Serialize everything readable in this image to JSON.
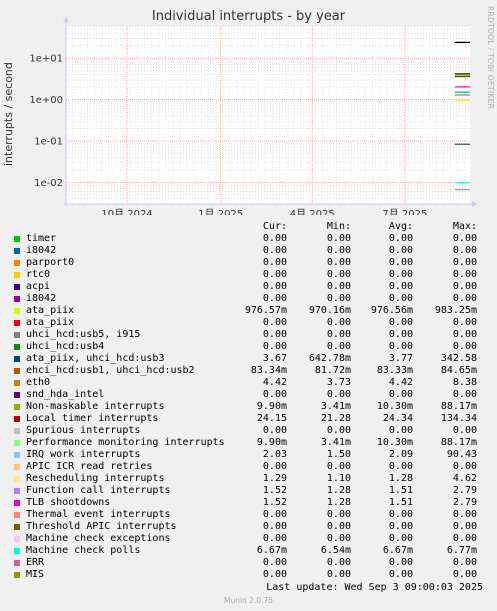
{
  "chart_data": {
    "type": "line",
    "title": "Individual interrupts - by year",
    "ylabel": "interrupts / second",
    "yscale": "log",
    "y_ticks": [
      {
        "value": 10,
        "label": "1e+01"
      },
      {
        "value": 1,
        "label": "1e+00"
      },
      {
        "value": 0.1,
        "label": "1e-01"
      },
      {
        "value": 0.01,
        "label": "1e-02"
      }
    ],
    "ylim": [
      0.003,
      60
    ],
    "x_ticks": [
      {
        "value": "2024-10-01",
        "label": "10月 2024"
      },
      {
        "value": "2025-01-01",
        "label": "1月 2025"
      },
      {
        "value": "2025-04-01",
        "label": "4月 2025"
      },
      {
        "value": "2025-07-01",
        "label": "7月 2025"
      }
    ],
    "xlim": [
      "2024-08-02",
      "2025-09-03"
    ],
    "grid": true,
    "segments": [
      {
        "color": "#cc0000",
        "x": [
          "2025-08-19",
          "2025-09-03"
        ],
        "y": 24.15
      },
      {
        "color": "#000000",
        "x": [
          "2025-08-19",
          "2025-09-03"
        ],
        "y": 24.0
      },
      {
        "color": "#c4a000",
        "x": [
          "2025-08-19",
          "2025-09-03"
        ],
        "y": 3.9
      },
      {
        "color": "#003333",
        "x": [
          "2025-08-19",
          "2025-09-03"
        ],
        "y": 4.2
      },
      {
        "color": "#336600",
        "x": [
          "2025-08-19",
          "2025-09-03"
        ],
        "y": 3.6
      },
      {
        "color": "#ff00ff",
        "x": [
          "2025-08-19",
          "2025-09-03"
        ],
        "y": 2.03
      },
      {
        "color": "#00aaaa",
        "x": [
          "2025-08-19",
          "2025-09-03"
        ],
        "y": 1.52
      },
      {
        "color": "#999900",
        "x": [
          "2025-08-19",
          "2025-09-03"
        ],
        "y": 1.29
      },
      {
        "color": "#ffd700",
        "x": [
          "2025-08-19",
          "2025-09-03"
        ],
        "y": 0.977
      },
      {
        "color": "#cc6600",
        "x": [
          "2025-08-19",
          "2025-09-03"
        ],
        "y": 0.0833
      },
      {
        "color": "#336666",
        "x": [
          "2025-08-19",
          "2025-09-03"
        ],
        "y": 0.0833
      },
      {
        "color": "#33ffcc",
        "x": [
          "2025-08-19",
          "2025-09-03"
        ],
        "y": 0.0099
      },
      {
        "color": "#33cccc",
        "x": [
          "2025-08-19",
          "2025-09-03"
        ],
        "y": 0.00667
      }
    ]
  },
  "legend": {
    "headers": {
      "cur": "Cur:",
      "min": "Min:",
      "avg": "Avg:",
      "max": "Max:"
    },
    "rows": [
      {
        "name": "timer",
        "color": "#00cc00",
        "cur": "0.00",
        "min": "0.00",
        "avg": "0.00",
        "max": "0.00"
      },
      {
        "name": "i8042",
        "color": "#0066b3",
        "cur": "0.00",
        "min": "0.00",
        "avg": "0.00",
        "max": "0.00"
      },
      {
        "name": "parport0",
        "color": "#ff8000",
        "cur": "0.00",
        "min": "0.00",
        "avg": "0.00",
        "max": "0.00"
      },
      {
        "name": "rtc0",
        "color": "#ffcc00",
        "cur": "0.00",
        "min": "0.00",
        "avg": "0.00",
        "max": "0.00"
      },
      {
        "name": "acpi",
        "color": "#330099",
        "cur": "0.00",
        "min": "0.00",
        "avg": "0.00",
        "max": "0.00"
      },
      {
        "name": "i8042",
        "color": "#990099",
        "cur": "0.00",
        "min": "0.00",
        "avg": "0.00",
        "max": "0.00"
      },
      {
        "name": "ata_piix",
        "color": "#ccff00",
        "cur": "976.57m",
        "min": "970.16m",
        "avg": "976.56m",
        "max": "983.25m"
      },
      {
        "name": "ata_piix",
        "color": "#ff0000",
        "cur": "0.00",
        "min": "0.00",
        "avg": "0.00",
        "max": "0.00"
      },
      {
        "name": "uhci_hcd:usb5, i915",
        "color": "#808080",
        "cur": "0.00",
        "min": "0.00",
        "avg": "0.00",
        "max": "0.00"
      },
      {
        "name": "uhci_hcd:usb4",
        "color": "#008f00",
        "cur": "0.00",
        "min": "0.00",
        "avg": "0.00",
        "max": "0.00"
      },
      {
        "name": "ata_piix, uhci_hcd:usb3",
        "color": "#00487d",
        "cur": "3.67",
        "min": "642.78m",
        "avg": "3.77",
        "max": "342.58"
      },
      {
        "name": "ehci_hcd:usb1, uhci_hcd:usb2",
        "color": "#b35a00",
        "cur": "83.34m",
        "min": "81.72m",
        "avg": "83.33m",
        "max": "84.65m"
      },
      {
        "name": "eth0",
        "color": "#b38f00",
        "cur": "4.42",
        "min": "3.73",
        "avg": "4.42",
        "max": "8.38"
      },
      {
        "name": "snd_hda_intel",
        "color": "#6b006b",
        "cur": "0.00",
        "min": "0.00",
        "avg": "0.00",
        "max": "0.00"
      },
      {
        "name": "Non-maskable interrupts",
        "color": "#8fb300",
        "cur": "9.90m",
        "min": "3.41m",
        "avg": "10.30m",
        "max": "88.17m"
      },
      {
        "name": "Local timer interrupts",
        "color": "#b30000",
        "cur": "24.15",
        "min": "21.28",
        "avg": "24.34",
        "max": "134.34"
      },
      {
        "name": "Spurious interrupts",
        "color": "#bebebe",
        "cur": "0.00",
        "min": "0.00",
        "avg": "0.00",
        "max": "0.00"
      },
      {
        "name": "Performance monitoring interrupts",
        "color": "#80ff80",
        "cur": "9.90m",
        "min": "3.41m",
        "avg": "10.30m",
        "max": "88.17m"
      },
      {
        "name": "IRQ work interrupts",
        "color": "#80c9ff",
        "cur": "2.03",
        "min": "1.50",
        "avg": "2.09",
        "max": "90.43"
      },
      {
        "name": "APIC ICR read retries",
        "color": "#ffc080",
        "cur": "0.00",
        "min": "0.00",
        "avg": "0.00",
        "max": "0.00"
      },
      {
        "name": "Rescheduling interrupts",
        "color": "#ffe680",
        "cur": "1.29",
        "min": "1.10",
        "avg": "1.28",
        "max": "4.62"
      },
      {
        "name": "Function call interrupts",
        "color": "#aa80ff",
        "cur": "1.52",
        "min": "1.28",
        "avg": "1.51",
        "max": "2.79"
      },
      {
        "name": "TLB shootdowns",
        "color": "#ee00cc",
        "cur": "1.52",
        "min": "1.28",
        "avg": "1.51",
        "max": "2.79"
      },
      {
        "name": "Thermal event interrupts",
        "color": "#ff8080",
        "cur": "0.00",
        "min": "0.00",
        "avg": "0.00",
        "max": "0.00"
      },
      {
        "name": "Threshold APIC interrupts",
        "color": "#666600",
        "cur": "0.00",
        "min": "0.00",
        "avg": "0.00",
        "max": "0.00"
      },
      {
        "name": "Machine check exceptions",
        "color": "#ffbfff",
        "cur": "0.00",
        "min": "0.00",
        "avg": "0.00",
        "max": "0.00"
      },
      {
        "name": "Machine check polls",
        "color": "#00ffcc",
        "cur": "6.67m",
        "min": "6.54m",
        "avg": "6.67m",
        "max": "6.77m"
      },
      {
        "name": "ERR",
        "color": "#cc6699",
        "cur": "0.00",
        "min": "0.00",
        "avg": "0.00",
        "max": "0.00"
      },
      {
        "name": "MIS",
        "color": "#999900",
        "cur": "0.00",
        "min": "0.00",
        "avg": "0.00",
        "max": "0.00"
      }
    ]
  },
  "footer": {
    "last_update": "Last update: Wed Sep  3 09:00:03 2025",
    "munin_version": "Munin 2.0.75",
    "credit": "RRDTOOL / TOBI OETIKER"
  }
}
